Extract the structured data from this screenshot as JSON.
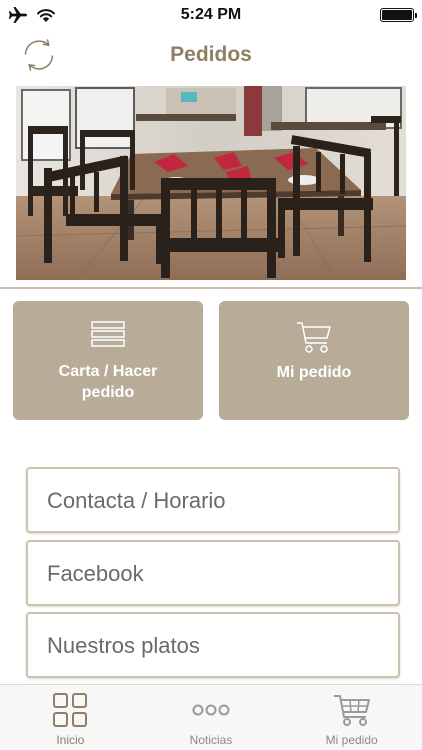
{
  "status_bar": {
    "time": "5:24 PM",
    "icons": [
      "airplane-icon",
      "wifi-icon",
      "battery-icon"
    ]
  },
  "nav": {
    "title": "Pedidos",
    "left_icon": "refresh-icon"
  },
  "hero": {
    "icon": "restaurant-photo",
    "description": "restaurant dining room photo"
  },
  "tiles": [
    {
      "label_line1": "Carta / Hacer",
      "label_line2": "pedido",
      "icon": "menu-lines-icon"
    },
    {
      "label": "Mi pedido",
      "icon": "cart-icon"
    }
  ],
  "list": [
    {
      "label": "Contacta / Horario"
    },
    {
      "label": "Facebook"
    },
    {
      "label": "Nuestros platos"
    }
  ],
  "tabbar": [
    {
      "label": "Inicio",
      "icon": "grid-icon",
      "active": true
    },
    {
      "label": "Noticias",
      "icon": "dots-icon",
      "active": false
    },
    {
      "label": "Mi pedido",
      "icon": "cart-icon",
      "active": false
    }
  ],
  "colors": {
    "accent": "#8f7f63",
    "tile_bg": "#b8ab98",
    "border": "#cdc2b0",
    "list_text": "#6a6a6a"
  }
}
